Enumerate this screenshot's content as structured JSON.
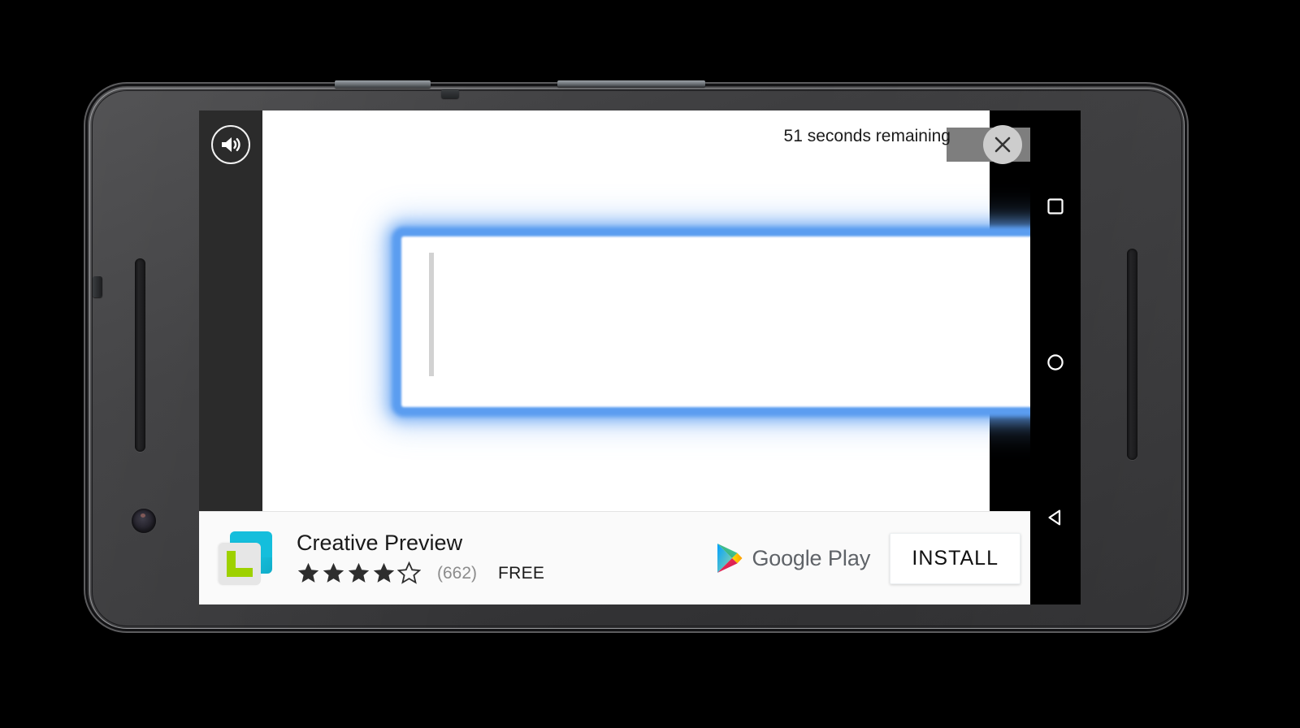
{
  "device": {
    "name": "android-phone-landscape",
    "body_color": "#3c3c3e",
    "rim_color": "#e1e4e8"
  },
  "video_ad": {
    "countdown_text": "51 seconds remaining",
    "close_label": "✕",
    "sound_icon": "volume-on-icon",
    "background_color": "#ffffff",
    "letterbox_color": "#2b2b2b",
    "focus_field_color": "#5b9df0",
    "close_button_color": "#cdcdcd",
    "countdown_bar_color": "#7e7e7e"
  },
  "ad_banner": {
    "app_icon": {
      "name": "creative-preview-app-icon",
      "cyan": "#14bedc",
      "gray": "#e6e6e6",
      "green": "#9ed100"
    },
    "app_title": "Creative Preview",
    "rating": {
      "filled_stars": 4,
      "total_stars": 5,
      "count_label": "(662)"
    },
    "price_label": "FREE",
    "store": {
      "brand_google": "Google",
      "brand_play": "Play",
      "logo_name": "google-play-triangle-icon"
    },
    "install_label": "INSTALL"
  },
  "navigation_bar": {
    "recents_label": "Recents",
    "home_label": "Home",
    "back_label": "Back",
    "icon_color": "#ffffff"
  }
}
